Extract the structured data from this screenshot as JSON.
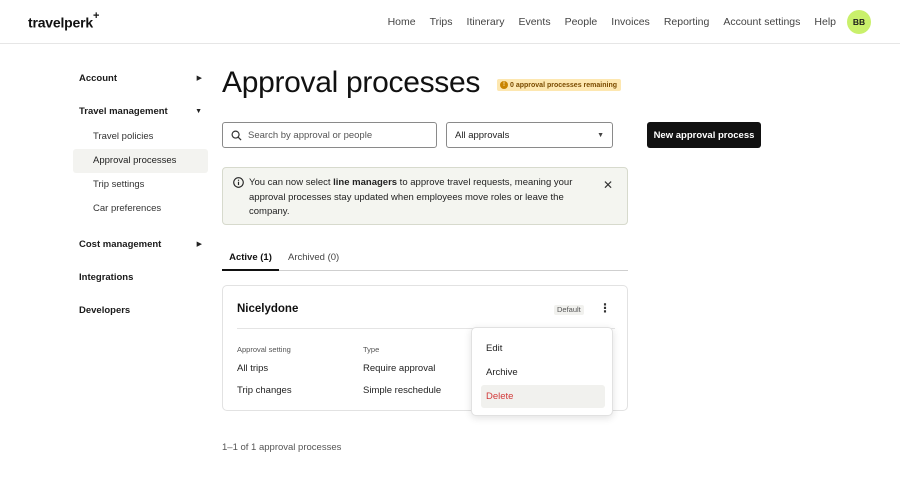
{
  "brand": {
    "logo": "travelperk",
    "logo_mark": "+"
  },
  "nav": {
    "items": [
      "Home",
      "Trips",
      "Itinerary",
      "Events",
      "People",
      "Invoices",
      "Reporting",
      "Account settings",
      "Help"
    ],
    "avatar_initials": "BB"
  },
  "sidebar": {
    "account": "Account",
    "travel_management": "Travel management",
    "travel_items": [
      "Travel policies",
      "Approval processes",
      "Trip settings",
      "Car preferences"
    ],
    "active_item": "Approval processes",
    "cost_management": "Cost management",
    "integrations": "Integrations",
    "developers": "Developers"
  },
  "page": {
    "title": "Approval processes",
    "badge": "0 approval processes remaining",
    "search_placeholder": "Search by approval or people",
    "filter_selected": "All approvals",
    "new_button": "New approval process"
  },
  "info_banner": {
    "part1": "You can now select ",
    "bold": "line managers",
    "part2": " to approve travel requests, meaning your approval processes stay updated when employees move roles or leave the company."
  },
  "tabs": {
    "active": "Active (1)",
    "archived": "Archived (0)"
  },
  "card": {
    "name": "Nicelydone",
    "default_badge": "Default",
    "col_setting": "Approval setting",
    "col_type": "Type",
    "rows": [
      {
        "setting": "All trips",
        "type": "Require approval"
      },
      {
        "setting": "Trip changes",
        "type": "Simple reschedule"
      }
    ]
  },
  "context_menu": {
    "edit": "Edit",
    "archive": "Archive",
    "delete": "Delete"
  },
  "footer": {
    "count": "1–1 of 1 approval processes"
  },
  "colors": {
    "accent_avatar": "#c9f06b",
    "badge_bg": "#fde7b0",
    "delete_red": "#d23a3a",
    "primary": "#111111"
  }
}
